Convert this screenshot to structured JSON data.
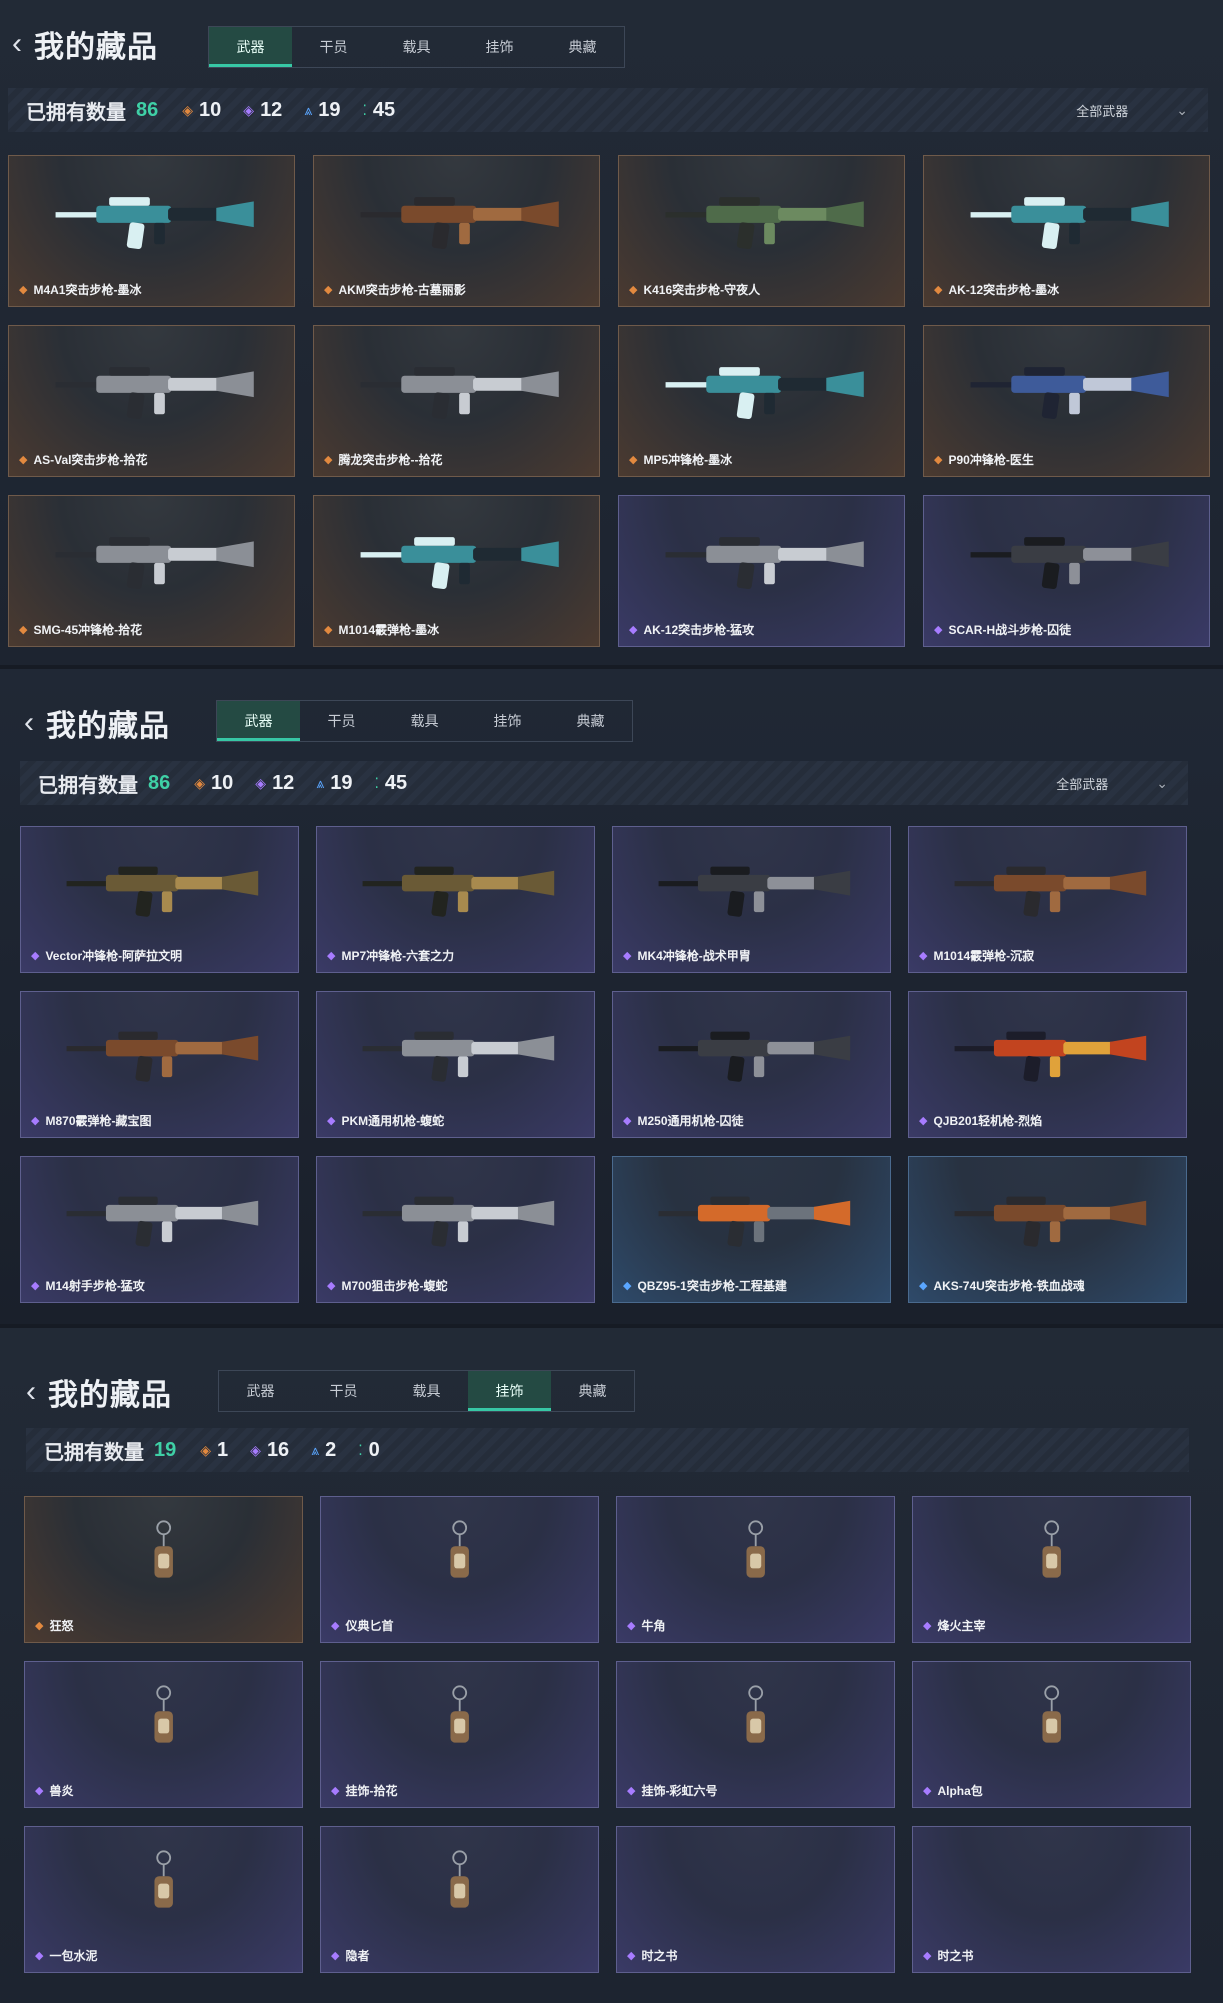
{
  "panels": [
    {
      "back_icon": "‹",
      "title": "我的藏品",
      "tabs": [
        "武器",
        "干员",
        "载具",
        "挂饰",
        "典藏"
      ],
      "active_tab": 0,
      "owned_label": "已拥有数量",
      "owned_count": "86",
      "stats": [
        {
          "icon": "diamond-gold",
          "symbol": "◈",
          "value": "10",
          "color": "#e2893f"
        },
        {
          "icon": "diamond-purple",
          "symbol": "◈",
          "value": "12",
          "color": "#a77cff"
        },
        {
          "icon": "chevrons-blue",
          "symbol": "⩓",
          "value": "19",
          "color": "#5aa6ff"
        },
        {
          "icon": "dots-green",
          "symbol": "⁚",
          "value": "45",
          "color": "#3fd0a6"
        }
      ],
      "filter": "全部武器",
      "items": [
        {
          "name": "M4A1突击步枪-墨冰",
          "rarity": "gold",
          "art": "teal"
        },
        {
          "name": "AKM突击步枪-古墓丽影",
          "rarity": "gold",
          "art": "wood"
        },
        {
          "name": "K416突击步枪-守夜人",
          "rarity": "gold",
          "art": "green"
        },
        {
          "name": "AK-12突击步枪-墨冰",
          "rarity": "gold",
          "art": "teal"
        },
        {
          "name": "AS-Val突击步枪-拾花",
          "rarity": "gold",
          "art": "gray"
        },
        {
          "name": "腾龙突击步枪--拾花",
          "rarity": "gold",
          "art": "gray"
        },
        {
          "name": "MP5冲锋枪-墨冰",
          "rarity": "gold",
          "art": "teal"
        },
        {
          "name": "P90冲锋枪-医生",
          "rarity": "gold",
          "art": "blue"
        },
        {
          "name": "SMG-45冲锋枪-拾花",
          "rarity": "gold",
          "art": "gray"
        },
        {
          "name": "M1014霰弹枪-墨冰",
          "rarity": "gold",
          "art": "teal"
        },
        {
          "name": "AK-12突击步枪-猛攻",
          "rarity": "purple",
          "art": "gray"
        },
        {
          "name": "SCAR-H战斗步枪-囚徒",
          "rarity": "purple",
          "art": "dark"
        }
      ]
    },
    {
      "back_icon": "‹",
      "title": "我的藏品",
      "tabs": [
        "武器",
        "干员",
        "载具",
        "挂饰",
        "典藏"
      ],
      "active_tab": 0,
      "owned_label": "已拥有数量",
      "owned_count": "86",
      "stats": [
        {
          "icon": "diamond-gold",
          "symbol": "◈",
          "value": "10",
          "color": "#e2893f"
        },
        {
          "icon": "diamond-purple",
          "symbol": "◈",
          "value": "12",
          "color": "#a77cff"
        },
        {
          "icon": "chevrons-blue",
          "symbol": "⩓",
          "value": "19",
          "color": "#5aa6ff"
        },
        {
          "icon": "dots-green",
          "symbol": "⁚",
          "value": "45",
          "color": "#3fd0a6"
        }
      ],
      "filter": "全部武器",
      "items": [
        {
          "name": "Vector冲锋枪-阿萨拉文明",
          "rarity": "purple",
          "art": "olive"
        },
        {
          "name": "MP7冲锋枪-六套之力",
          "rarity": "purple",
          "art": "olive"
        },
        {
          "name": "MK4冲锋枪-战术甲胄",
          "rarity": "purple",
          "art": "dark"
        },
        {
          "name": "M1014霰弹枪-沉寂",
          "rarity": "purple",
          "art": "wood"
        },
        {
          "name": "M870霰弹枪-藏宝图",
          "rarity": "purple",
          "art": "wood"
        },
        {
          "name": "PKM通用机枪-蝮蛇",
          "rarity": "purple",
          "art": "gray"
        },
        {
          "name": "M250通用机枪-囚徒",
          "rarity": "purple",
          "art": "dark"
        },
        {
          "name": "QJB201轻机枪-烈焰",
          "rarity": "purple",
          "art": "fire"
        },
        {
          "name": "M14射手步枪-猛攻",
          "rarity": "purple",
          "art": "gray"
        },
        {
          "name": "M700狙击步枪-蝮蛇",
          "rarity": "purple",
          "art": "gray"
        },
        {
          "name": "QBZ95-1突击步枪-工程基建",
          "rarity": "blue",
          "art": "orange"
        },
        {
          "name": "AKS-74U突击步枪-铁血战魂",
          "rarity": "blue",
          "art": "wood"
        }
      ]
    },
    {
      "back_icon": "‹",
      "title": "我的藏品",
      "tabs": [
        "武器",
        "干员",
        "载具",
        "挂饰",
        "典藏"
      ],
      "active_tab": 3,
      "owned_label": "已拥有数量",
      "owned_count": "19",
      "stats": [
        {
          "icon": "diamond-gold",
          "symbol": "◈",
          "value": "1",
          "color": "#e2893f"
        },
        {
          "icon": "diamond-purple",
          "symbol": "◈",
          "value": "16",
          "color": "#a77cff"
        },
        {
          "icon": "chevrons-blue",
          "symbol": "⩓",
          "value": "2",
          "color": "#5aa6ff"
        },
        {
          "icon": "dots-green",
          "symbol": "⁚",
          "value": "0",
          "color": "#3fd0a6"
        }
      ],
      "filter": "",
      "items": [
        {
          "name": "狂怒",
          "rarity": "gold",
          "art": "charm"
        },
        {
          "name": "仪典匕首",
          "rarity": "purple",
          "art": "charm"
        },
        {
          "name": "牛角",
          "rarity": "purple",
          "art": "charm"
        },
        {
          "name": "烽火主宰",
          "rarity": "purple",
          "art": "charm"
        },
        {
          "name": "兽炎",
          "rarity": "purple",
          "art": "charm"
        },
        {
          "name": "挂饰-拾花",
          "rarity": "purple",
          "art": "charm"
        },
        {
          "name": "挂饰-彩虹六号",
          "rarity": "purple",
          "art": "charm"
        },
        {
          "name": "Alpha包",
          "rarity": "purple",
          "art": "charm"
        },
        {
          "name": "一包水泥",
          "rarity": "purple",
          "art": "charm"
        },
        {
          "name": "隐者",
          "rarity": "purple",
          "art": "charm"
        },
        {
          "name": "时之书",
          "rarity": "purple",
          "art": "none"
        },
        {
          "name": "时之书",
          "rarity": "purple",
          "art": "none"
        }
      ]
    }
  ]
}
